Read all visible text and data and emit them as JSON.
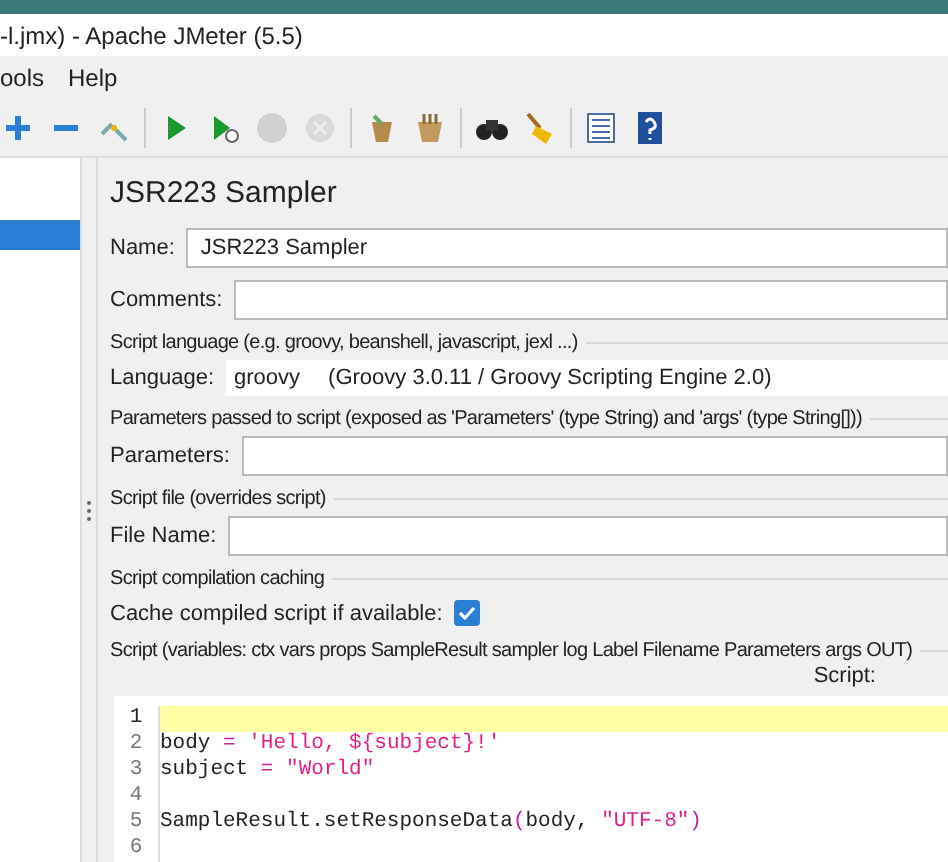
{
  "window": {
    "title": "-l.jmx) - Apache JMeter (5.5)"
  },
  "menu": [
    "ools",
    "Help"
  ],
  "toolbar": [
    {
      "kind": "plus",
      "disabled": false
    },
    {
      "kind": "minus",
      "disabled": false
    },
    {
      "kind": "toggle",
      "disabled": false
    },
    {
      "kind": "start",
      "disabled": false
    },
    {
      "kind": "start-no-timers",
      "disabled": false
    },
    {
      "kind": "stop",
      "disabled": true
    },
    {
      "kind": "shutdown",
      "disabled": true
    },
    {
      "kind": "clear",
      "disabled": false
    },
    {
      "kind": "clear-all",
      "disabled": false
    },
    {
      "kind": "search",
      "disabled": false
    },
    {
      "kind": "reset-search",
      "disabled": false
    },
    {
      "kind": "functions",
      "disabled": false
    },
    {
      "kind": "help",
      "disabled": false
    }
  ],
  "tree": {
    "rows": [
      {
        "selected": true
      }
    ]
  },
  "panel": {
    "title": "JSR223 Sampler",
    "name": {
      "label": "Name:",
      "value": "JSR223 Sampler"
    },
    "comments": {
      "label": "Comments:"
    },
    "language_section": "Script language (e.g. groovy, beanshell, javascript, jexl ...)",
    "language": {
      "label": "Language:",
      "value": "groovy",
      "engine": "(Groovy 3.0.11 / Groovy Scripting Engine 2.0)"
    },
    "parameters_section": "Parameters passed to script (exposed as 'Parameters' (type String) and 'args' (type String[]))",
    "parameters": {
      "label": "Parameters:"
    },
    "file_section": "Script file (overrides script)",
    "file_name": {
      "label": "File Name:"
    },
    "caching_section": "Script compilation caching",
    "cache": {
      "label": "Cache compiled script if available:",
      "checked": true
    },
    "script_section": "Script (variables: ctx vars props SampleResult sampler log Label Filename Parameters args OUT)",
    "script_label": "Script:",
    "editor": {
      "lines": [
        {
          "number": "1",
          "current": true
        },
        {
          "number": "2",
          "current": false,
          "tokens": [
            {
              "kind": "plain",
              "text": "body "
            },
            {
              "kind": "operator",
              "text": "="
            },
            {
              "kind": "string",
              "text": " 'Hello, ${subject}!'"
            }
          ]
        },
        {
          "number": "3",
          "current": false,
          "tokens": [
            {
              "kind": "plain",
              "text": "subject "
            },
            {
              "kind": "operator",
              "text": "="
            },
            {
              "kind": "string",
              "text": " \"World\""
            }
          ]
        },
        {
          "number": "4",
          "current": false
        },
        {
          "number": "5",
          "current": false,
          "tokens": [
            {
              "kind": "plain",
              "text": "SampleResult.setResponseData"
            },
            {
              "kind": "operator",
              "text": "("
            },
            {
              "kind": "plain",
              "text": "body, "
            },
            {
              "kind": "string",
              "text": "\"UTF-8\""
            },
            {
              "kind": "operator",
              "text": ")"
            }
          ]
        },
        {
          "number": "6",
          "current": false
        }
      ]
    }
  }
}
